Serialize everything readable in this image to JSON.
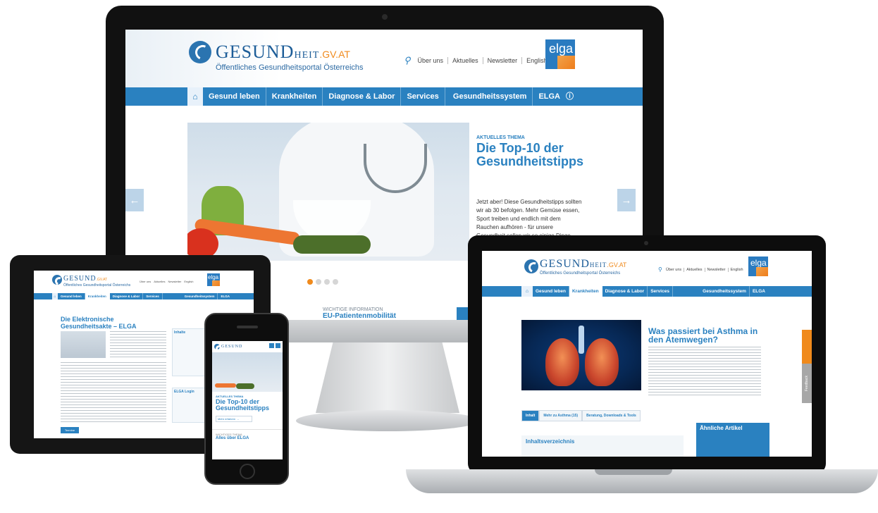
{
  "site": {
    "brand_main": "GESUND",
    "brand_small": "HEIT",
    "brand_tld": ".GV.AT",
    "subtitle": "Öffentliches Gesundheitsportal Österreichs",
    "elga_logo": "elga"
  },
  "desktop": {
    "top_links": [
      "Über uns",
      "Aktuelles",
      "Newsletter",
      "English"
    ],
    "nav_left": [
      "Gesund leben",
      "Krankheiten",
      "Diagnose & Labor",
      "Services"
    ],
    "nav_right": [
      "Gesundheitssystem",
      "ELGA"
    ],
    "hero_kicker": "AKTUELLES THEMA",
    "hero_title": "Die Top-10 der Gesundheitstipps",
    "hero_text": "Jetzt aber! Diese Gesundheitstipps sollten wir ab 30 befolgen. Mehr Gemüse essen, Sport treiben und endlich mit dem Rauchen aufhören - für unsere Gesundheit sollen wir so einige Dinge machen.",
    "info_kicker": "WICHTIGE INFORMATION",
    "info_title": "EU-Patientenmobilität",
    "arrow_prev": "←",
    "arrow_next": "→"
  },
  "tablet": {
    "nav_left": [
      "Gesund leben",
      "Krankheiten",
      "Diagnose & Labor",
      "Services"
    ],
    "nav_right": [
      "Gesundheitssystem",
      "ELGA"
    ],
    "title": "Die Elektronische Gesundheitsakte – ELGA",
    "box1": "Inhalte",
    "box2": "ELGA Login",
    "button": "Termine"
  },
  "phone": {
    "kicker": "AKTUELLES THEMA",
    "title": "Die Top-10 der Gesundheitstipps",
    "more": "Mehr erfahren →",
    "section_kicker": "WICHTIGES THEMA",
    "section_title": "Alles über ELGA"
  },
  "laptop": {
    "nav_left": [
      "Gesund leben",
      "Krankheiten",
      "Diagnose & Labor",
      "Services"
    ],
    "nav_right": [
      "Gesundheitssystem",
      "ELGA"
    ],
    "title": "Was passiert bei Asthma in den Atemwegen?",
    "tabs": [
      "Inhalt",
      "Mehr zu Asthma (15)",
      "Beratung, Downloads & Tools"
    ],
    "toc_title": "Inhaltsverzeichnis",
    "related_title": "Ähnliche Artikel",
    "feedback": "Feedback"
  },
  "colors": {
    "primary": "#2a81c0",
    "accent": "#f08a1c"
  }
}
